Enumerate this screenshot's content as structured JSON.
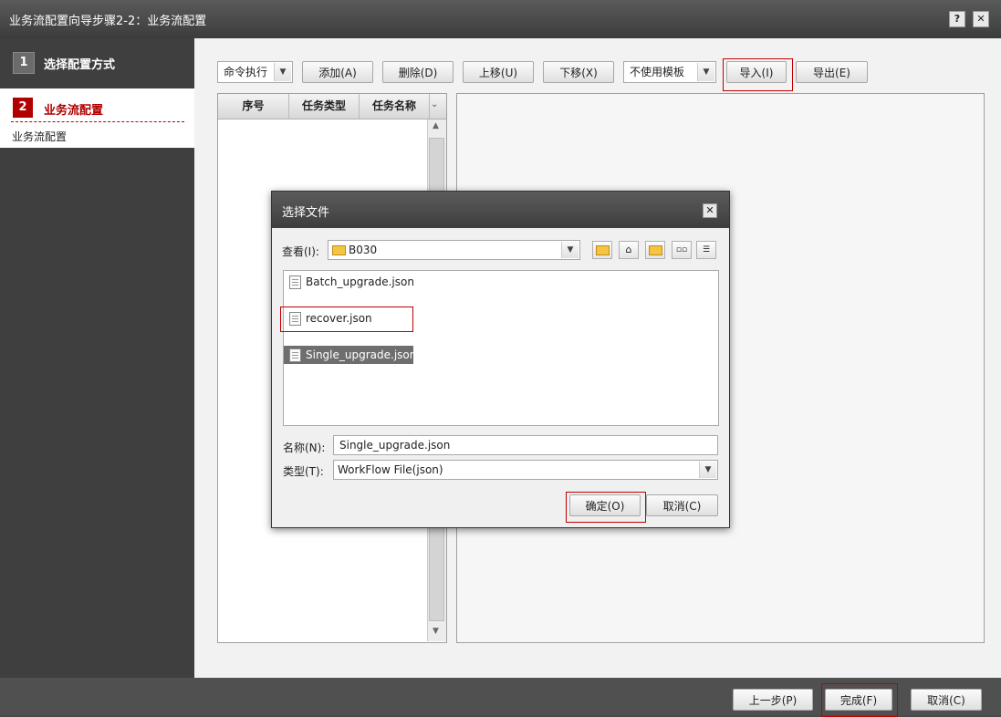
{
  "window": {
    "title": "业务流配置向导步骤2-2：业务流配置",
    "help_label": "?",
    "close_label": "✕"
  },
  "sidebar": {
    "step1": {
      "number": "1",
      "label": "选择配置方式"
    },
    "step2": {
      "number": "2",
      "label": "业务流配置",
      "sub_label": "业务流配置"
    }
  },
  "toolbar": {
    "exec_select": "命令执行",
    "add": "添加(A)",
    "delete": "删除(D)",
    "move_up": "上移(U)",
    "move_down": "下移(X)",
    "template_select": "不使用模板",
    "import": "导入(I)",
    "export": "导出(E)"
  },
  "task_table": {
    "columns": [
      "序号",
      "任务类型",
      "任务名称"
    ]
  },
  "dialog": {
    "title": "选择文件",
    "close_label": "✕",
    "look_in_label": "查看(I):",
    "look_in_value": "B030",
    "files": [
      "Batch_upgrade.json",
      "recover.json",
      "Single_upgrade.json"
    ],
    "selected_file": "Single_upgrade.json",
    "name_label": "名称(N):",
    "name_value": "Single_upgrade.json",
    "type_label": "类型(T):",
    "type_value": "WorkFlow File(json)",
    "ok": "确定(O)",
    "cancel": "取消(C)"
  },
  "footer": {
    "prev": "上一步(P)",
    "finish": "完成(F)",
    "cancel": "取消(C)"
  },
  "colors": {
    "accent_red": "#c00000",
    "titlebar": "#4a4a4a",
    "selection": "#6e6e6e"
  }
}
